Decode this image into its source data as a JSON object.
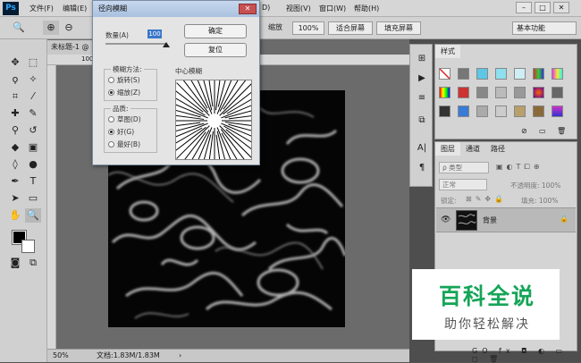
{
  "app": {
    "logo": "Ps"
  },
  "menu": [
    "文件(F)",
    "编辑(E)",
    "D)",
    "视图(V)",
    "窗口(W)",
    "帮助(H)"
  ],
  "window_controls": [
    "–",
    "□",
    "✕"
  ],
  "options_bar": {
    "buttons": [
      "缩放",
      "100%",
      "适合屏幕",
      "填充屏幕"
    ],
    "workspace": "基本功能"
  },
  "document": {
    "tab": "未标题-1 @",
    "ruler_mark": "100",
    "zoom": "50%",
    "doc_info": "文档:1.83M/1.83M"
  },
  "dialog": {
    "title": "径向模糊",
    "close": "✕",
    "amount_label": "数量(A)",
    "amount_value": "100",
    "ok": "确定",
    "reset": "复位",
    "method_label": "模糊方法:",
    "method_options": [
      "旋转(S)",
      "缩放(Z)"
    ],
    "quality_label": "品质:",
    "quality_options": [
      "草图(D)",
      "好(G)",
      "最好(B)"
    ],
    "center_label": "中心模糊"
  },
  "panels": {
    "swatch_tab": "样式",
    "layer_tabs": [
      "图层",
      "通道",
      "路径"
    ],
    "kind_label": "ρ 类型",
    "blend_mode": "正常",
    "opacity_label": "不透明度: 100%",
    "lock_label": "锁定:",
    "fill_label": "填充: 100%",
    "layer_name": "背景",
    "bottom_icons": "GO fx ◘ ◐ ▭ ◻ 🗑"
  },
  "watermark": {
    "line1": "百科全说",
    "line2": "助你轻松解决"
  },
  "colors": {
    "accent": "#15a557",
    "ps_blue": "#31a8ff",
    "dock": "#4e4e4e"
  }
}
